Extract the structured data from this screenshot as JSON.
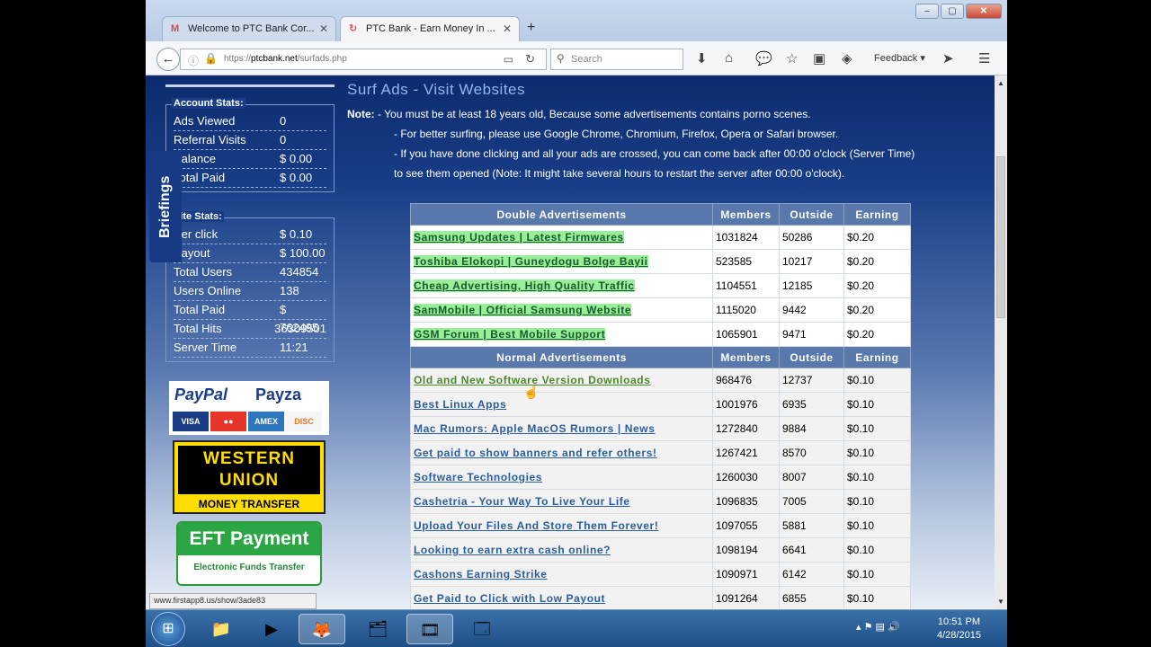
{
  "browser": {
    "tabs": [
      {
        "label": "Welcome to PTC Bank Cor...",
        "icon": "gmail-icon"
      },
      {
        "label": "PTC Bank - Earn Money In ...",
        "icon": "ptc-icon"
      }
    ],
    "url_prefix": "https://",
    "url_domain": "ptcbank.net",
    "url_path": "/surfads.php",
    "search_placeholder": "Search",
    "feedback_label": "Feedback",
    "status_url": "www.firstapp8.us/show/3ade83"
  },
  "sidebar": {
    "briefings_label": "Briefings",
    "account_stats": {
      "title": "Account Stats:",
      "rows": [
        {
          "k": "Ads Viewed",
          "v": "0"
        },
        {
          "k": "Referral Visits",
          "v": "0"
        },
        {
          "k": "Balance",
          "v": "$ 0.00"
        },
        {
          "k": "Total Paid",
          "v": "$ 0.00"
        }
      ]
    },
    "site_stats": {
      "title": "Site Stats:",
      "rows": [
        {
          "k": "Per click",
          "v": "$ 0.10"
        },
        {
          "k": "Payout",
          "v": "$ 100.00"
        },
        {
          "k": "Total Users",
          "v": "434854"
        },
        {
          "k": "Users Online",
          "v": "138"
        },
        {
          "k": "Total Paid",
          "v": "$ 762495"
        },
        {
          "k": "Total Hits",
          "v": "36309501"
        },
        {
          "k": "Server Time",
          "v": "11:21"
        }
      ]
    },
    "payment": {
      "paypal": "PayPal",
      "payza": "Payza",
      "visa": "VISA",
      "western_union": "WESTERN UNION",
      "money_transfer": "MONEY TRANSFER",
      "eft": "EFT Payment",
      "eft_sub": "Electronic Funds Transfer"
    }
  },
  "main": {
    "title": "Surf Ads - Visit Websites",
    "note_label": "Note:",
    "notes": [
      "- You must be at least 18 years old, Because some advertisements contains porno scenes.",
      "- For better surfing, please use Google Chrome, Chromium, Firefox, Opera or Safari browser.",
      "- If you have done clicking and all your ads are crossed, you can come back after 00:00 o'clock (Server Time)",
      "to see them opened (Note: It might take several hours to restart the server after 00:00 o'clock)."
    ],
    "double_header": [
      "Double Advertisements",
      "Members",
      "Outside",
      "Earning"
    ],
    "double_ads": [
      [
        "Samsung Updates | Latest Firmwares",
        "1031824",
        "50286",
        "$0.20"
      ],
      [
        "Toshiba Elokopi | Guneydogu Bolge Bayii",
        "523585",
        "10217",
        "$0.20"
      ],
      [
        "Cheap Advertising, High Quality Traffic",
        "1104551",
        "12185",
        "$0.20"
      ],
      [
        "SamMobile | Official Samsung Website",
        "1115020",
        "9442",
        "$0.20"
      ],
      [
        "GSM Forum | Best Mobile Support",
        "1065901",
        "9471",
        "$0.20"
      ]
    ],
    "normal_header": [
      "Normal Advertisements",
      "Members",
      "Outside",
      "Earning"
    ],
    "normal_ads": [
      [
        "Old and New Software Version Downloads",
        "968476",
        "12737",
        "$0.10"
      ],
      [
        "Best Linux Apps",
        "1001976",
        "6935",
        "$0.10"
      ],
      [
        "Mac Rumors: Apple MacOS Rumors | News",
        "1272840",
        "9884",
        "$0.10"
      ],
      [
        "Get paid to show banners and refer others!",
        "1267421",
        "8570",
        "$0.10"
      ],
      [
        "Software Technologies",
        "1260030",
        "8007",
        "$0.10"
      ],
      [
        "Cashetria - Your Way To Live Your Life",
        "1096835",
        "7005",
        "$0.10"
      ],
      [
        "Upload Your Files And Store Them Forever!",
        "1097055",
        "5881",
        "$0.10"
      ],
      [
        "Looking to earn extra cash online?",
        "1098194",
        "6641",
        "$0.10"
      ],
      [
        "Cashons Earning Strike",
        "1090971",
        "6142",
        "$0.10"
      ],
      [
        "Get Paid to Click with Low Payout",
        "1091264",
        "6855",
        "$0.10"
      ]
    ]
  },
  "taskbar": {
    "time": "10:51 PM",
    "date": "4/28/2015"
  }
}
